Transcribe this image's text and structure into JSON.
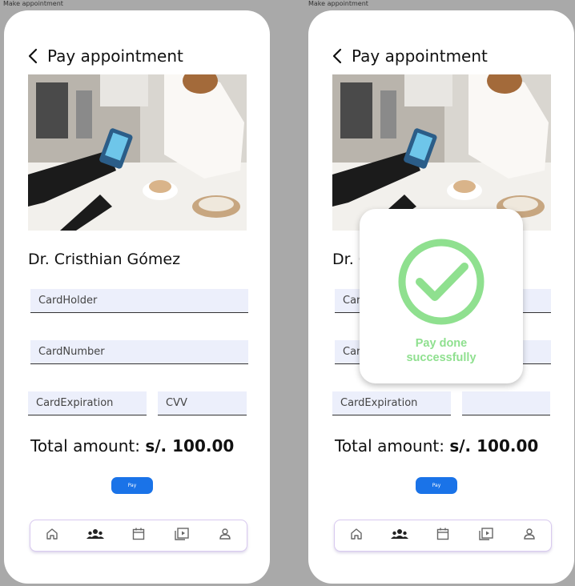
{
  "screens": [
    {
      "frame_label": "Make appointment",
      "title": "Pay appointment",
      "doctor_name": "Dr. Cristhian Gómez",
      "fields": {
        "cardholder_placeholder": "CardHolder",
        "cardnumber_placeholder": "CardNumber",
        "cardexpiration_placeholder": "CardExpiration",
        "cvv_placeholder": "CVV"
      },
      "total_label": "Total amount:",
      "total_value": "s/. 100.00",
      "pay_label": "Pay"
    },
    {
      "frame_label": "Make appointment",
      "title": "Pay appointment",
      "doctor_name_partial": "Dr. C",
      "fields": {
        "cardholder_partial": "Car",
        "cardnumber_partial": "Car",
        "cardexpiration_placeholder": "CardExpiration"
      },
      "background_text": "Success",
      "modal_message": "Pay done successfully",
      "total_label": "Total amount:",
      "total_value": "s/. 100.00",
      "pay_label": "Pay"
    }
  ],
  "nav_items": [
    "home-icon",
    "community-icon",
    "calendar-icon",
    "video-library-icon",
    "profile-icon"
  ],
  "colors": {
    "primary_button": "#1a73e8",
    "field_bg": "#eceffb",
    "success_green": "#8fe08f",
    "nav_border": "#d8c9ef"
  }
}
